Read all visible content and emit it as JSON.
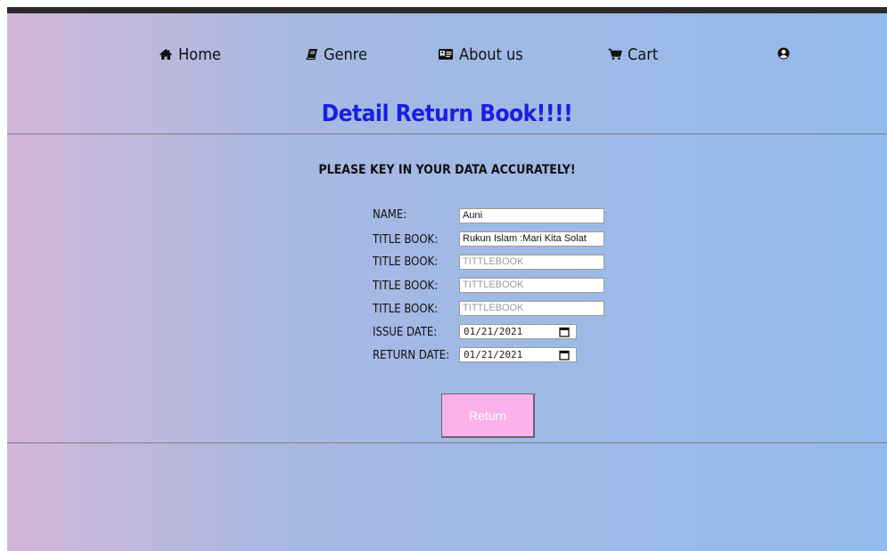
{
  "colors": {
    "gradient_left": "#d2b6d7",
    "gradient_mid": "#a7b9e3",
    "gradient_right": "#93baea",
    "title": "#1d1de0",
    "button_bg": "#fbb2ea"
  },
  "nav": {
    "home": {
      "label": "Home",
      "icon": "home-icon"
    },
    "genre": {
      "label": "Genre",
      "icon": "book-icon"
    },
    "about": {
      "label": "About us",
      "icon": "id-card-icon"
    },
    "cart": {
      "label": "Cart",
      "icon": "cart-icon"
    },
    "account": {
      "icon": "user-circle-icon"
    }
  },
  "page_title": "Detail Return Book!!!!",
  "subtitle": "PLEASE KEY IN YOUR DATA ACCURATELY!",
  "form": {
    "name": {
      "label": "NAME:",
      "value": "Auni"
    },
    "title1": {
      "label": "TITLE BOOK:",
      "value": "Rukun Islam :Mari Kita Solat"
    },
    "title2": {
      "label": "TITLE BOOK:",
      "placeholder": "TITTLEBOOK"
    },
    "title3": {
      "label": "TITLE BOOK:",
      "placeholder": "TITTLEBOOK"
    },
    "title4": {
      "label": "TITLE BOOK:",
      "placeholder": "TITTLEBOOK"
    },
    "issue_date": {
      "label": "ISSUE DATE:",
      "value": "01/21/2021"
    },
    "return_date": {
      "label": "RETURN DATE:",
      "value": "01/21/2021"
    }
  },
  "submit_label": "Return"
}
